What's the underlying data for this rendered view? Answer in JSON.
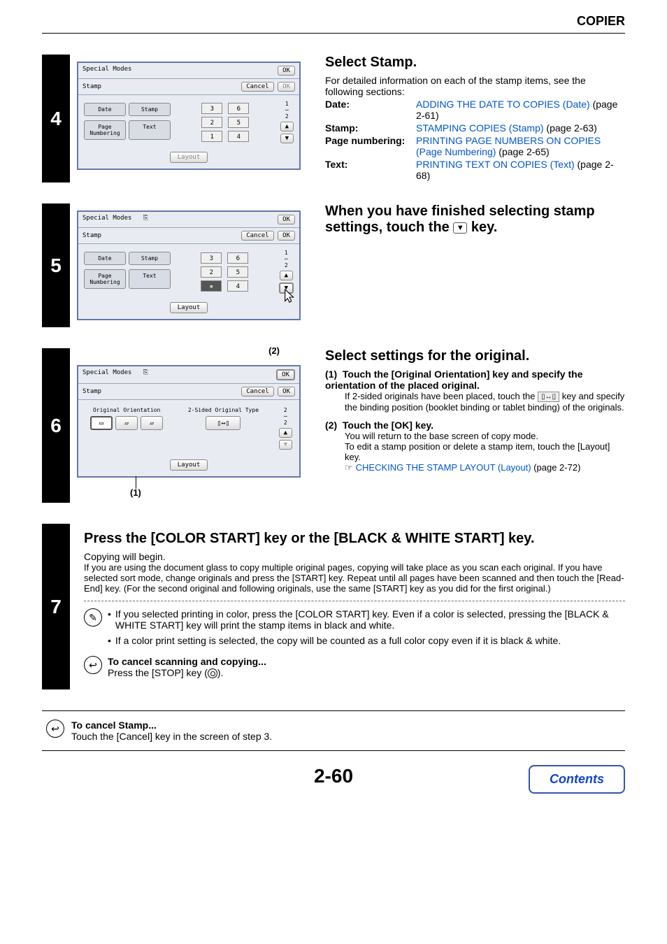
{
  "header": "COPIER",
  "page_number": "2-60",
  "contents_button": "Contents",
  "screens": {
    "special_modes": "Special Modes",
    "ok": "OK",
    "cancel": "Cancel",
    "stamp": "Stamp",
    "date": "Date",
    "stamp_btn": "Stamp",
    "page_numbering": "Page\nNumbering",
    "text": "Text",
    "layout": "Layout",
    "fraction_12_top": "1",
    "fraction_12_bot": "2",
    "fraction_22_top": "2",
    "fraction_22_bot": "2",
    "orig_orient": "Original Orientation",
    "two_sided": "2-Sided Original Type",
    "callout_1": "(1)",
    "callout_2": "(2)"
  },
  "step4": {
    "num": "4",
    "title": "Select Stamp.",
    "intro": "For detailed information on each of the stamp items, see the following sections:",
    "items": {
      "date_label": "Date:",
      "date_link": "ADDING THE DATE TO COPIES (Date)",
      "date_ref": " (page 2-61)",
      "stamp_label": "Stamp:",
      "stamp_link": "STAMPING COPIES (Stamp)",
      "stamp_ref": " (page 2-63)",
      "pn_label": "Page numbering:",
      "pn_link": "PRINTING PAGE NUMBERS ON COPIES (Page Numbering)",
      "pn_ref": " (page 2-65)",
      "text_label": "Text:",
      "text_link": "PRINTING TEXT ON COPIES (Text)",
      "text_ref": " (page 2-68)"
    }
  },
  "step5": {
    "num": "5",
    "title_a": "When you have finished selecting stamp settings, touch the ",
    "title_b": " key."
  },
  "step6": {
    "num": "6",
    "title": "Select settings for the original.",
    "p1_label": "(1)",
    "p1_title": "Touch the [Original Orientation] key and specify the orientation of the placed original.",
    "p1_body_a": "If 2-sided originals have been placed, touch the ",
    "p1_body_b": " key and specify the binding position (booklet binding or tablet binding) of the originals.",
    "p2_label": "(2)",
    "p2_title": "Touch the [OK] key.",
    "p2_body_a": "You will return to the base screen of copy mode.",
    "p2_body_b": "To edit a stamp position or delete a stamp item, touch the [Layout] key.",
    "p2_link": "CHECKING THE STAMP LAYOUT (Layout)",
    "p2_ref": " (page 2-72)"
  },
  "step7": {
    "num": "7",
    "title": "Press the [COLOR START] key or the [BLACK & WHITE START] key.",
    "p1": "Copying will begin.",
    "p2": "If you are using the document glass to copy multiple original pages, copying will take place as you scan each original. If you have selected sort mode, change originals and press the [START] key. Repeat until all pages have been scanned and then touch the [Read-End] key. (For the second original and following originals, use the same [START] key as you did for the first original.)",
    "b1": "If you selected printing in color, press the [COLOR START] key. Even if a color is selected, pressing the [BLACK & WHITE START] key will print the stamp items in black and white.",
    "b2": "If a color print setting is selected, the copy will be counted as a full color copy even if it is black & white.",
    "cancel_h": "To cancel scanning and copying...",
    "cancel_b_a": "Press the [STOP] key (",
    "cancel_b_b": ")."
  },
  "cancel_note": {
    "h": "To cancel Stamp...",
    "b": "Touch the [Cancel] key in the screen of step 3."
  }
}
